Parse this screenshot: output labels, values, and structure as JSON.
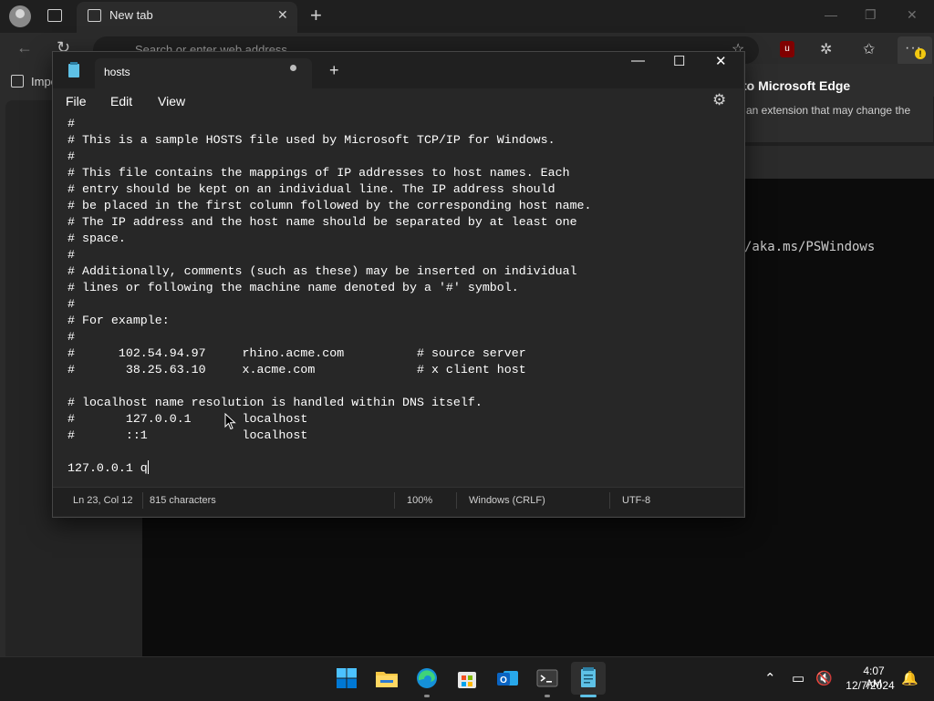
{
  "browser": {
    "tab_title": "New tab",
    "address_placeholder": "Search or enter web address",
    "favorites_label": "Impo",
    "popup_title": "to Microsoft Edge",
    "popup_body": "an extension that may change the",
    "terminal_text": "/aka.ms/PSWindows"
  },
  "notepad": {
    "tab_title": "hosts",
    "menu": [
      "File",
      "Edit",
      "View"
    ],
    "content_lines": [
      "#",
      "# This is a sample HOSTS file used by Microsoft TCP/IP for Windows.",
      "#",
      "# This file contains the mappings of IP addresses to host names. Each",
      "# entry should be kept on an individual line. The IP address should",
      "# be placed in the first column followed by the corresponding host name.",
      "# The IP address and the host name should be separated by at least one",
      "# space.",
      "#",
      "# Additionally, comments (such as these) may be inserted on individual",
      "# lines or following the machine name denoted by a '#' symbol.",
      "#",
      "# For example:",
      "#",
      "#      102.54.94.97     rhino.acme.com          # source server",
      "#       38.25.63.10     x.acme.com              # x client host",
      "",
      "# localhost name resolution is handled within DNS itself.",
      "#       127.0.0.1       localhost",
      "#       ::1             localhost",
      "",
      "127.0.0.1 q"
    ],
    "status": {
      "position": "Ln 23, Col 12",
      "characters": "815 characters",
      "zoom": "100%",
      "line_ending": "Windows (CRLF)",
      "encoding": "UTF-8"
    }
  },
  "taskbar": {
    "time": "4:07 AM",
    "date": "12/7/2024",
    "apps": [
      "windows-start-icon",
      "file-explorer-icon",
      "edge-icon",
      "store-icon",
      "outlook-icon",
      "terminal-icon",
      "notepad-icon"
    ]
  },
  "colors": {
    "accent": "#5ec1e6",
    "notepad_bg": "#272727",
    "titlebar_bg": "#202020"
  }
}
